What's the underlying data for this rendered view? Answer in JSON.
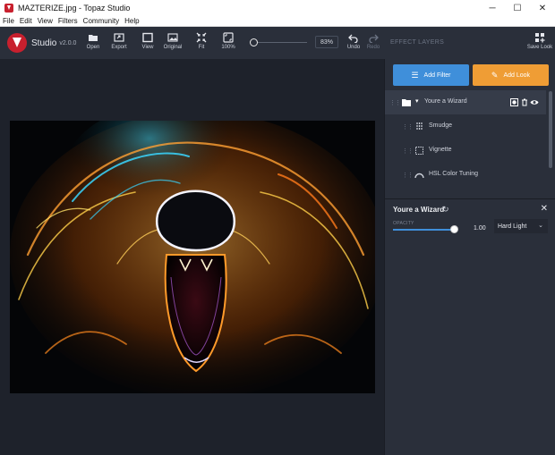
{
  "window": {
    "title": "MAZTERIZE.jpg - Topaz Studio",
    "controls": [
      "─",
      "☐",
      "✕"
    ]
  },
  "menu": [
    "File",
    "Edit",
    "View",
    "Filters",
    "Community",
    "Help"
  ],
  "brand": {
    "name": "Studio",
    "version": "v2.0.0",
    "accent": "#c8202e"
  },
  "toolbar": {
    "tools": [
      {
        "label": "Open",
        "icon": "folder-icon"
      },
      {
        "label": "Export",
        "icon": "export-icon"
      },
      {
        "label": "View",
        "icon": "view-icon"
      },
      {
        "label": "Original",
        "icon": "image-icon"
      },
      {
        "label": "Fit",
        "icon": "fit-icon"
      },
      {
        "label": "100%",
        "icon": "actual-size-icon"
      }
    ],
    "zoom": "83%",
    "undo": "Undo",
    "redo": "Redo",
    "save_look": "Save Look",
    "panel_heading": "EFFECT LAYERS"
  },
  "panel": {
    "add_filter": "Add Filter",
    "add_look": "Add Look",
    "add_filter_color": "#3f8fda",
    "add_look_color": "#ef9d35",
    "group": "Youre a Wizard",
    "layers": [
      "Smudge",
      "Vignette",
      "HSL Color Tuning"
    ]
  },
  "props": {
    "title": "Youre a Wizard",
    "opacity_label": "OPACITY",
    "opacity_value": "1.00",
    "opacity_fraction": 1.0,
    "blend_mode": "Hard Light"
  }
}
